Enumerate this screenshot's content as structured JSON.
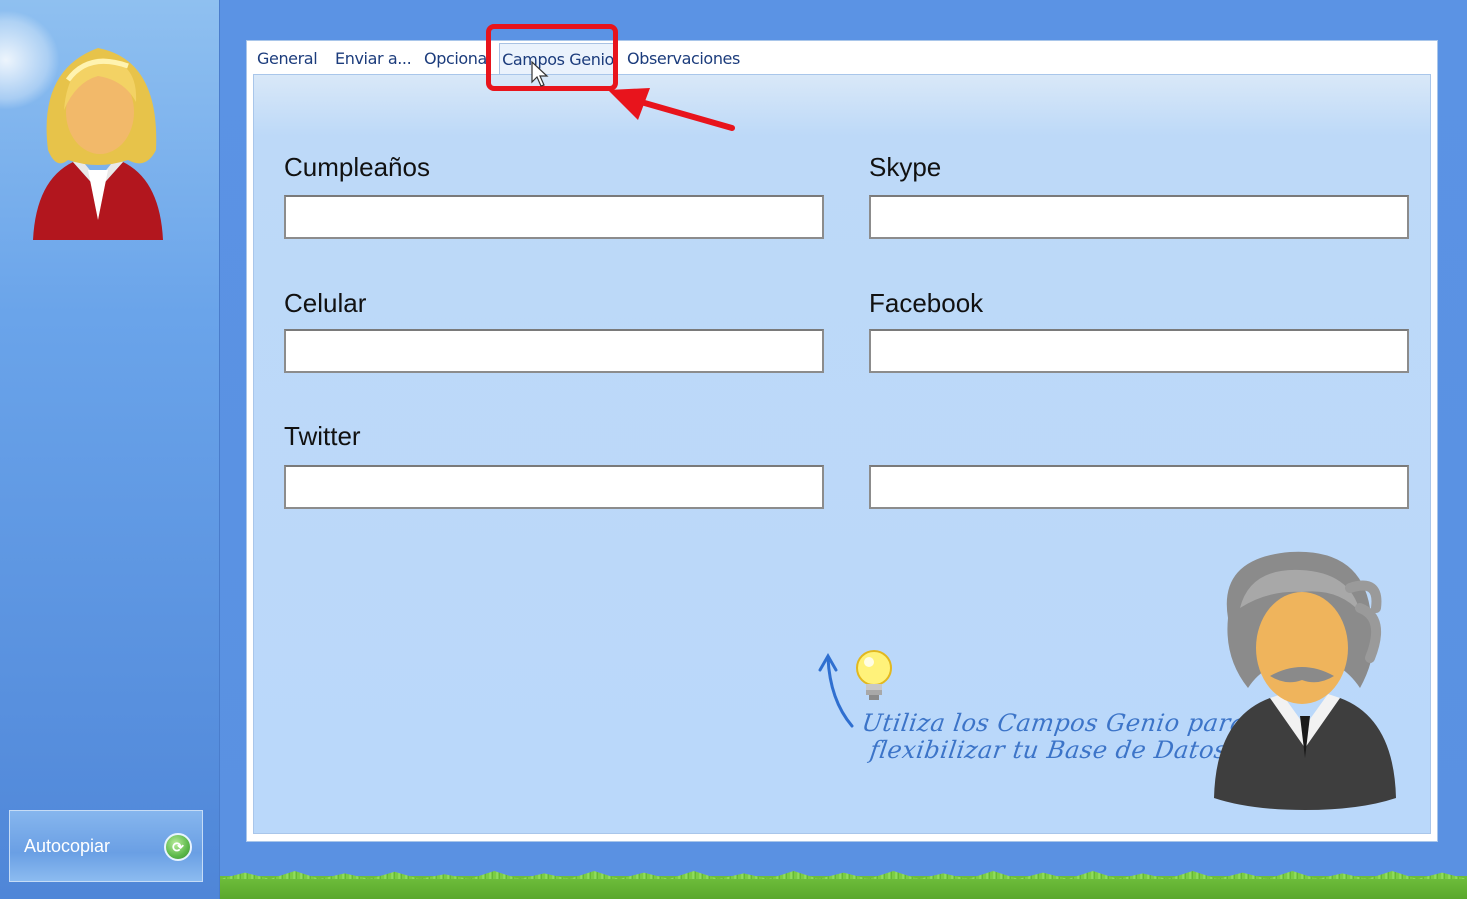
{
  "sidebar": {
    "autocopy_label": "Autocopiar",
    "autocopy_icon": "refresh-icon"
  },
  "tabs": [
    {
      "label": "General"
    },
    {
      "label": "Enviar a..."
    },
    {
      "label": "Opciona"
    },
    {
      "label": "Campos Genio",
      "active": true
    },
    {
      "label": "Observaciones"
    }
  ],
  "fields": {
    "cumpleanos": {
      "label": "Cumpleaños",
      "value": ""
    },
    "skype": {
      "label": "Skype",
      "value": ""
    },
    "celular": {
      "label": "Celular",
      "value": ""
    },
    "facebook": {
      "label": "Facebook",
      "value": ""
    },
    "twitter": {
      "label": "Twitter",
      "value": ""
    },
    "extra": {
      "label": "",
      "value": ""
    }
  },
  "hint": {
    "line1": "Utiliza los Campos Genio para",
    "line2": "flexibilizar tu Base de Datos"
  },
  "colors": {
    "highlight": "#e8141c",
    "panel_bg": "#bad8fa",
    "sidebar_bg": "#6aa4ea"
  }
}
